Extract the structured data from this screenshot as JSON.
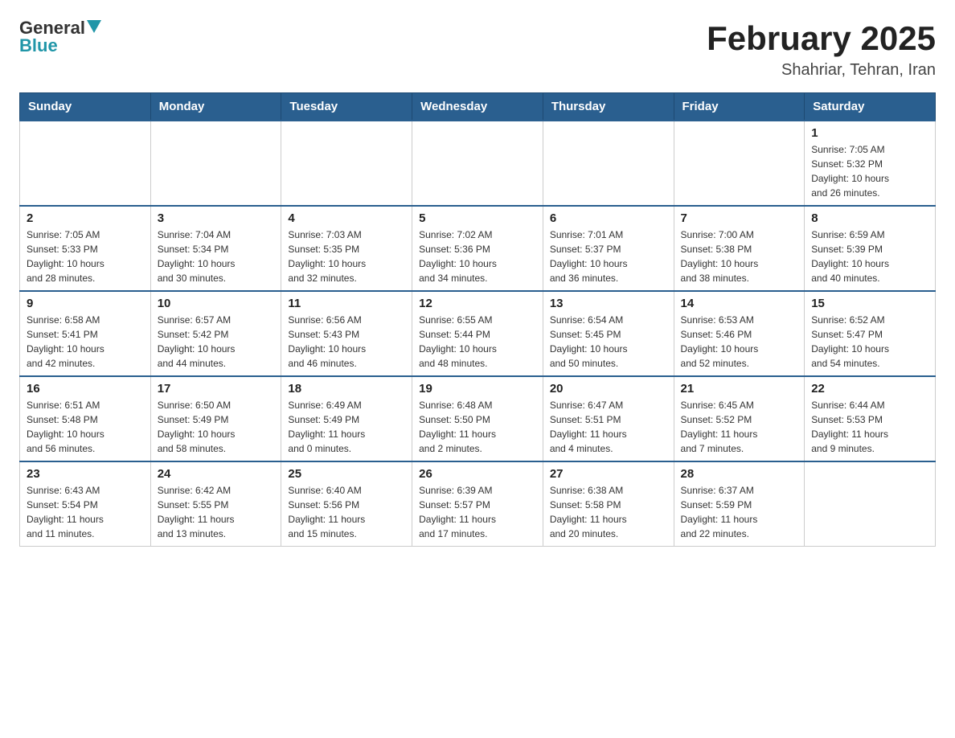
{
  "header": {
    "logo_general": "General",
    "logo_blue": "Blue",
    "title": "February 2025",
    "location": "Shahriar, Tehran, Iran"
  },
  "calendar": {
    "days_of_week": [
      "Sunday",
      "Monday",
      "Tuesday",
      "Wednesday",
      "Thursday",
      "Friday",
      "Saturday"
    ],
    "weeks": [
      [
        {
          "day": "",
          "info": ""
        },
        {
          "day": "",
          "info": ""
        },
        {
          "day": "",
          "info": ""
        },
        {
          "day": "",
          "info": ""
        },
        {
          "day": "",
          "info": ""
        },
        {
          "day": "",
          "info": ""
        },
        {
          "day": "1",
          "info": "Sunrise: 7:05 AM\nSunset: 5:32 PM\nDaylight: 10 hours\nand 26 minutes."
        }
      ],
      [
        {
          "day": "2",
          "info": "Sunrise: 7:05 AM\nSunset: 5:33 PM\nDaylight: 10 hours\nand 28 minutes."
        },
        {
          "day": "3",
          "info": "Sunrise: 7:04 AM\nSunset: 5:34 PM\nDaylight: 10 hours\nand 30 minutes."
        },
        {
          "day": "4",
          "info": "Sunrise: 7:03 AM\nSunset: 5:35 PM\nDaylight: 10 hours\nand 32 minutes."
        },
        {
          "day": "5",
          "info": "Sunrise: 7:02 AM\nSunset: 5:36 PM\nDaylight: 10 hours\nand 34 minutes."
        },
        {
          "day": "6",
          "info": "Sunrise: 7:01 AM\nSunset: 5:37 PM\nDaylight: 10 hours\nand 36 minutes."
        },
        {
          "day": "7",
          "info": "Sunrise: 7:00 AM\nSunset: 5:38 PM\nDaylight: 10 hours\nand 38 minutes."
        },
        {
          "day": "8",
          "info": "Sunrise: 6:59 AM\nSunset: 5:39 PM\nDaylight: 10 hours\nand 40 minutes."
        }
      ],
      [
        {
          "day": "9",
          "info": "Sunrise: 6:58 AM\nSunset: 5:41 PM\nDaylight: 10 hours\nand 42 minutes."
        },
        {
          "day": "10",
          "info": "Sunrise: 6:57 AM\nSunset: 5:42 PM\nDaylight: 10 hours\nand 44 minutes."
        },
        {
          "day": "11",
          "info": "Sunrise: 6:56 AM\nSunset: 5:43 PM\nDaylight: 10 hours\nand 46 minutes."
        },
        {
          "day": "12",
          "info": "Sunrise: 6:55 AM\nSunset: 5:44 PM\nDaylight: 10 hours\nand 48 minutes."
        },
        {
          "day": "13",
          "info": "Sunrise: 6:54 AM\nSunset: 5:45 PM\nDaylight: 10 hours\nand 50 minutes."
        },
        {
          "day": "14",
          "info": "Sunrise: 6:53 AM\nSunset: 5:46 PM\nDaylight: 10 hours\nand 52 minutes."
        },
        {
          "day": "15",
          "info": "Sunrise: 6:52 AM\nSunset: 5:47 PM\nDaylight: 10 hours\nand 54 minutes."
        }
      ],
      [
        {
          "day": "16",
          "info": "Sunrise: 6:51 AM\nSunset: 5:48 PM\nDaylight: 10 hours\nand 56 minutes."
        },
        {
          "day": "17",
          "info": "Sunrise: 6:50 AM\nSunset: 5:49 PM\nDaylight: 10 hours\nand 58 minutes."
        },
        {
          "day": "18",
          "info": "Sunrise: 6:49 AM\nSunset: 5:49 PM\nDaylight: 11 hours\nand 0 minutes."
        },
        {
          "day": "19",
          "info": "Sunrise: 6:48 AM\nSunset: 5:50 PM\nDaylight: 11 hours\nand 2 minutes."
        },
        {
          "day": "20",
          "info": "Sunrise: 6:47 AM\nSunset: 5:51 PM\nDaylight: 11 hours\nand 4 minutes."
        },
        {
          "day": "21",
          "info": "Sunrise: 6:45 AM\nSunset: 5:52 PM\nDaylight: 11 hours\nand 7 minutes."
        },
        {
          "day": "22",
          "info": "Sunrise: 6:44 AM\nSunset: 5:53 PM\nDaylight: 11 hours\nand 9 minutes."
        }
      ],
      [
        {
          "day": "23",
          "info": "Sunrise: 6:43 AM\nSunset: 5:54 PM\nDaylight: 11 hours\nand 11 minutes."
        },
        {
          "day": "24",
          "info": "Sunrise: 6:42 AM\nSunset: 5:55 PM\nDaylight: 11 hours\nand 13 minutes."
        },
        {
          "day": "25",
          "info": "Sunrise: 6:40 AM\nSunset: 5:56 PM\nDaylight: 11 hours\nand 15 minutes."
        },
        {
          "day": "26",
          "info": "Sunrise: 6:39 AM\nSunset: 5:57 PM\nDaylight: 11 hours\nand 17 minutes."
        },
        {
          "day": "27",
          "info": "Sunrise: 6:38 AM\nSunset: 5:58 PM\nDaylight: 11 hours\nand 20 minutes."
        },
        {
          "day": "28",
          "info": "Sunrise: 6:37 AM\nSunset: 5:59 PM\nDaylight: 11 hours\nand 22 minutes."
        },
        {
          "day": "",
          "info": ""
        }
      ]
    ]
  }
}
